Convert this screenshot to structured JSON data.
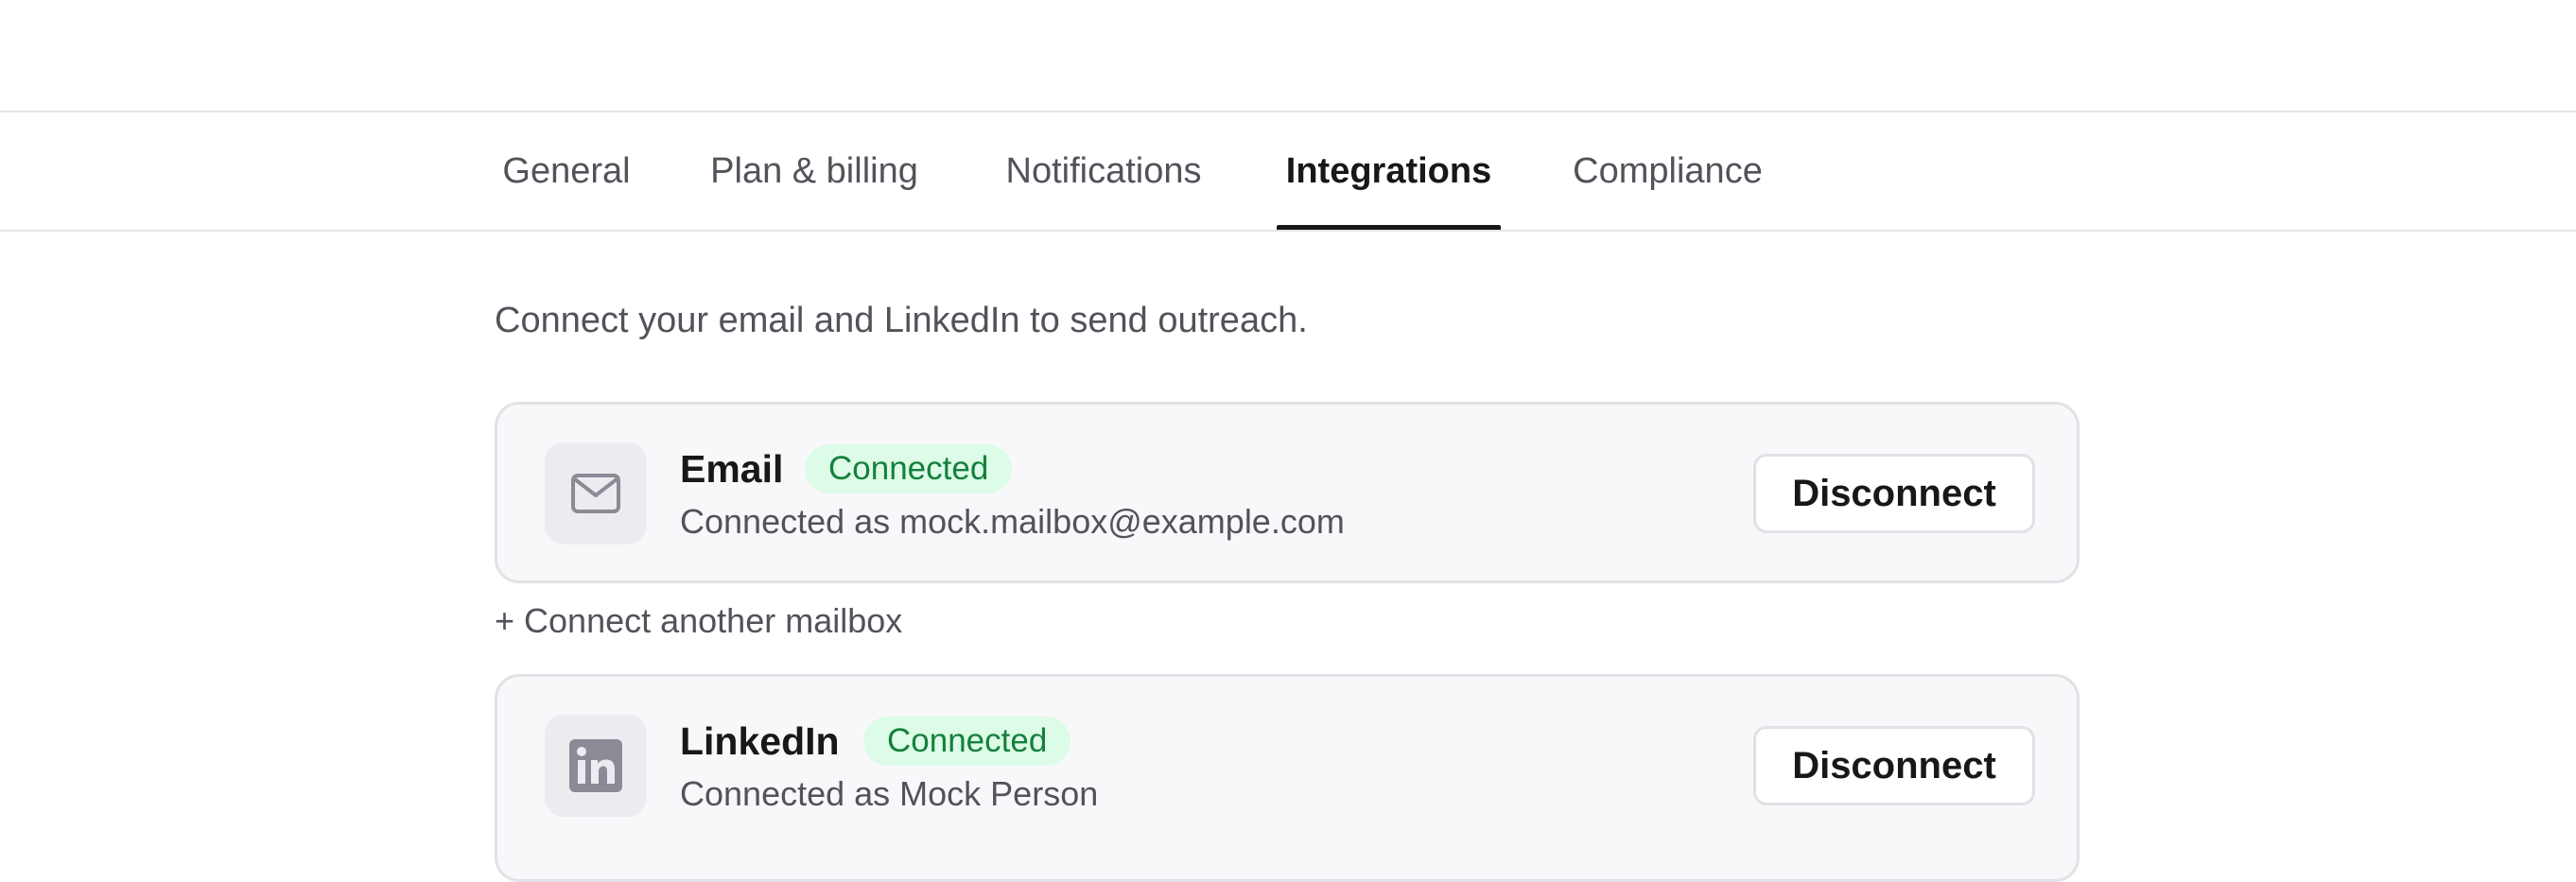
{
  "tabs": [
    {
      "label": "General",
      "active": false
    },
    {
      "label": "Plan & billing",
      "active": false
    },
    {
      "label": "Notifications",
      "active": false
    },
    {
      "label": "Integrations",
      "active": true
    },
    {
      "label": "Compliance",
      "active": false
    }
  ],
  "intro_text": "Connect your email and LinkedIn to send outreach.",
  "integrations": {
    "email": {
      "name": "Email",
      "status": "Connected",
      "detail": "Connected as mock.mailbox@example.com",
      "action_label": "Disconnect",
      "icon": "mail-icon"
    },
    "add_mailbox_label": "+ Connect another mailbox",
    "linkedin": {
      "name": "LinkedIn",
      "status": "Connected",
      "detail": "Connected as Mock Person",
      "action_label": "Disconnect",
      "icon": "linkedin-icon"
    }
  },
  "colors": {
    "text_primary": "#18181b",
    "text_secondary": "#52525b",
    "badge_bg": "#dcfce7",
    "badge_text": "#15803d",
    "card_bg": "#f8f8fa",
    "border": "#e1e1e6",
    "icon_gray": "#8b8b96"
  }
}
